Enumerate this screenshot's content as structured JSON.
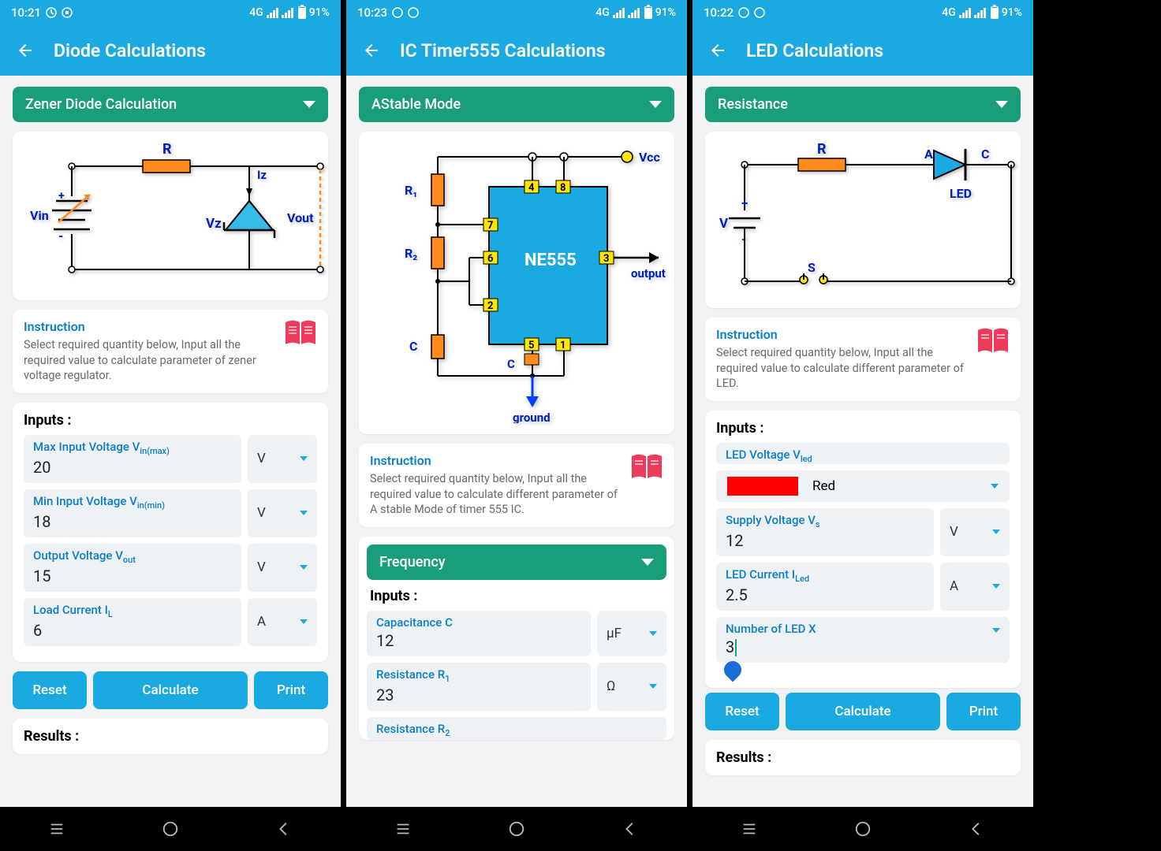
{
  "panels": [
    {
      "time": "10:21",
      "network": "4G",
      "battery": "91%",
      "title": "Diode Calculations",
      "section": "Zener Diode Calculation",
      "instruction_title": "Instruction",
      "instruction_text": "Select required quantity below, Input all the required value to calculate parameter of zener voltage regulator.",
      "inputs_label": "Inputs :",
      "fields": {
        "max_vin": {
          "label": "Max Input Voltage V",
          "sub": "in(max)",
          "value": "20",
          "unit": "V"
        },
        "min_vin": {
          "label": "Min Input Voltage V",
          "sub": "in(min)",
          "value": "18",
          "unit": "V"
        },
        "vout": {
          "label": "Output Voltage V",
          "sub": "out",
          "value": "15",
          "unit": "V"
        },
        "il": {
          "label": "Load Current I",
          "sub": "L",
          "value": "6",
          "unit": "A"
        }
      },
      "buttons": {
        "reset": "Reset",
        "calc": "Calculate",
        "print": "Print"
      },
      "results_label": "Results :"
    },
    {
      "time": "10:23",
      "network": "4G",
      "battery": "91%",
      "title": "IC Timer555 Calculations",
      "section": "AStable Mode",
      "instruction_title": "Instruction",
      "instruction_text": "Select required quantity below, Input all the required value to calculate different parameter of A stable Mode of timer 555 IC.",
      "sub_section": "Frequency",
      "inputs_label": "Inputs :",
      "fields": {
        "cap": {
          "label": "Capacitance C",
          "value": "12",
          "unit": "µF"
        },
        "r1": {
          "label": "Resistance R",
          "sub": "1",
          "value": "23",
          "unit": "Ω"
        },
        "r2": {
          "label": "Resistance R",
          "sub": "2"
        }
      },
      "diagram": {
        "vcc": "Vcc",
        "r1": "R₁",
        "r2": "R₂",
        "c": "C",
        "ic": "NE555",
        "out": "output",
        "gnd": "ground",
        "cpin": "C"
      }
    },
    {
      "time": "10:22",
      "network": "4G",
      "battery": "91%",
      "title": "LED Calculations",
      "section": "Resistance",
      "instruction_title": "Instruction",
      "instruction_text": "Select required quantity below, Input all the required value to calculate different parameter of LED.",
      "inputs_label": "Inputs :",
      "fields": {
        "vled": {
          "label": "LED Voltage V",
          "sub": "led",
          "color_name": "Red"
        },
        "vs": {
          "label": "Supply Voltage V",
          "sub": "s",
          "value": "12",
          "unit": "V"
        },
        "iled": {
          "label": "LED Current I",
          "sub": "Led",
          "value": "2.5",
          "unit": "A"
        },
        "x": {
          "label": "Number of LED X",
          "value": "3"
        }
      },
      "buttons": {
        "reset": "Reset",
        "calc": "Calculate",
        "print": "Print"
      },
      "results_label": "Results :",
      "diagram": {
        "r": "R",
        "v": "V",
        "s": "S",
        "a": "A",
        "c": "C",
        "led": "LED"
      }
    }
  ],
  "diagram1": {
    "r": "R",
    "vin": "Vin",
    "iz": "Iz",
    "vz": "Vz",
    "vout": "Vout"
  }
}
